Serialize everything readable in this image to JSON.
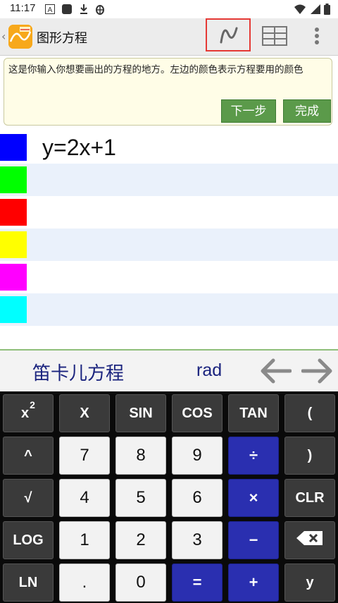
{
  "status_bar": {
    "time": "11:17"
  },
  "action_bar": {
    "title": "图形方程"
  },
  "hint": {
    "text": "这是你输入你想要画出的方程的地方。左边的颜色表示方程要用的颜色",
    "next_label": "下一步",
    "done_label": "完成"
  },
  "equations": [
    {
      "color": "#0000ff",
      "text": "y=2x+1"
    },
    {
      "color": "#00ff00",
      "text": ""
    },
    {
      "color": "#ff0000",
      "text": ""
    },
    {
      "color": "#ffff00",
      "text": ""
    },
    {
      "color": "#ff00ff",
      "text": ""
    },
    {
      "color": "#00ffff",
      "text": ""
    }
  ],
  "mode_bar": {
    "coordinate_mode": "笛卡儿方程",
    "angle_mode": "rad"
  },
  "keypad": {
    "rows": [
      [
        {
          "label": "x",
          "sup": "2",
          "style": "dark",
          "name": "key-square"
        },
        {
          "label": "X",
          "style": "dark",
          "name": "key-x"
        },
        {
          "label": "SIN",
          "style": "dark",
          "name": "key-sin"
        },
        {
          "label": "COS",
          "style": "dark",
          "name": "key-cos"
        },
        {
          "label": "TAN",
          "style": "dark",
          "name": "key-tan"
        },
        {
          "label": "(",
          "style": "dark",
          "name": "key-open-paren"
        }
      ],
      [
        {
          "label": "^",
          "style": "dark",
          "name": "key-power"
        },
        {
          "label": "7",
          "style": "light",
          "name": "key-7"
        },
        {
          "label": "8",
          "style": "light",
          "name": "key-8"
        },
        {
          "label": "9",
          "style": "light",
          "name": "key-9"
        },
        {
          "label": "÷",
          "style": "blue",
          "name": "key-divide"
        },
        {
          "label": ")",
          "style": "dark",
          "name": "key-close-paren"
        }
      ],
      [
        {
          "label": "√",
          "style": "dark",
          "name": "key-sqrt"
        },
        {
          "label": "4",
          "style": "light",
          "name": "key-4"
        },
        {
          "label": "5",
          "style": "light",
          "name": "key-5"
        },
        {
          "label": "6",
          "style": "light",
          "name": "key-6"
        },
        {
          "label": "×",
          "style": "blue",
          "name": "key-multiply"
        },
        {
          "label": "CLR",
          "style": "dark",
          "name": "key-clear"
        }
      ],
      [
        {
          "label": "LOG",
          "style": "dark",
          "name": "key-log"
        },
        {
          "label": "1",
          "style": "light",
          "name": "key-1"
        },
        {
          "label": "2",
          "style": "light",
          "name": "key-2"
        },
        {
          "label": "3",
          "style": "light",
          "name": "key-3"
        },
        {
          "label": "−",
          "style": "blue",
          "name": "key-minus"
        },
        {
          "label": "",
          "icon": "backspace-icon",
          "style": "dark",
          "name": "key-backspace"
        }
      ],
      [
        {
          "label": "LN",
          "style": "dark",
          "name": "key-ln"
        },
        {
          "label": ".",
          "style": "light",
          "name": "key-decimal"
        },
        {
          "label": "0",
          "style": "light",
          "name": "key-0"
        },
        {
          "label": "=",
          "style": "blue",
          "name": "key-equals"
        },
        {
          "label": "+",
          "style": "blue",
          "name": "key-plus"
        },
        {
          "label": "y",
          "style": "dark",
          "name": "key-y"
        }
      ]
    ]
  },
  "icons": {
    "status": [
      "notification-a-icon",
      "square-icon",
      "download-icon",
      "bug-icon",
      "wifi-icon",
      "signal-icon",
      "battery-icon"
    ],
    "toolbar": [
      "graph-icon",
      "table-icon",
      "more-vert-icon"
    ],
    "nav": [
      "arrow-left-icon",
      "arrow-right-icon"
    ]
  }
}
